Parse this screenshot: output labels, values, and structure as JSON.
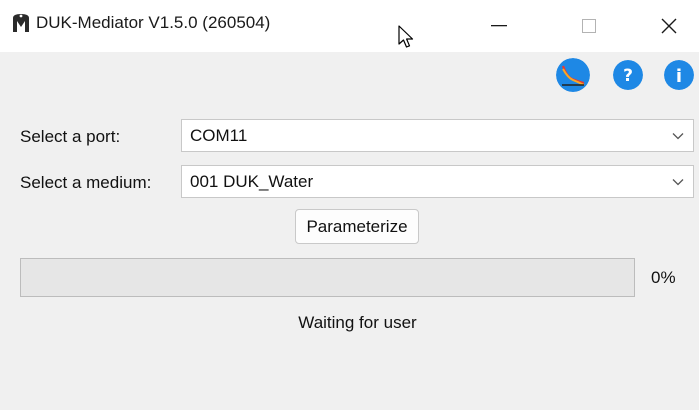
{
  "window": {
    "title": "DUK-Mediator V1.5.0 (260504)",
    "controls": {
      "minimize_icon": "minimize-icon",
      "maximize_icon": "maximize-icon",
      "close_icon": "close-icon"
    }
  },
  "toolbar": {
    "icons": [
      "curve-chart-icon",
      "help-icon",
      "info-icon"
    ],
    "help_glyph": "?",
    "info_glyph": "i",
    "accent_color": "#1e88e5"
  },
  "form": {
    "port_label": "Select a port:",
    "port_value": "COM11",
    "medium_label": "Select a medium:",
    "medium_value": "001 DUK_Water",
    "parameterize_label": "Parameterize"
  },
  "progress": {
    "percent_text": "0%",
    "fraction": 0
  },
  "status": {
    "text": "Waiting for user"
  }
}
